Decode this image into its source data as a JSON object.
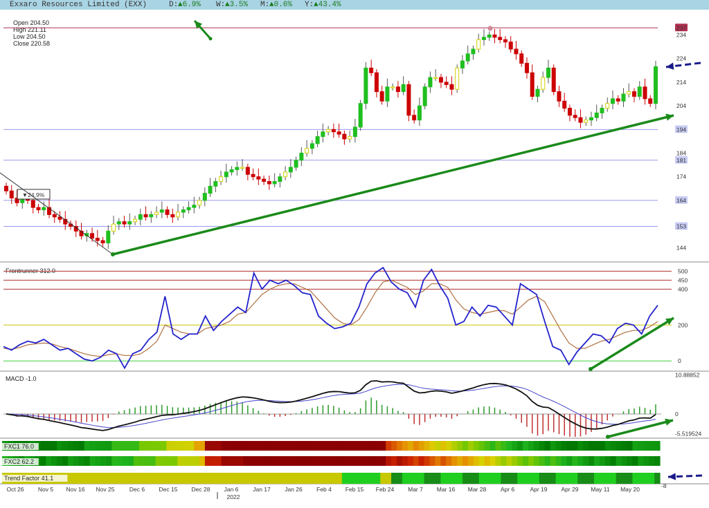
{
  "header": {
    "title": "Exxaro Resources Limited (EXX)",
    "d_label": "D:",
    "d_value": "▲6.9%",
    "w_label": "W:",
    "w_value": "▲3.5%",
    "m_label": "M:",
    "m_value": "▲0.6%",
    "y_label": "Y:",
    "y_value": "▲43.4%"
  },
  "ohlc": {
    "open": "Open 204.50",
    "high": "High 221.11",
    "low": "Low 204.50",
    "close": "Close 220.58"
  },
  "colors": {
    "up_green": "#1fbf1f",
    "up_yellow": "#d4d400",
    "down_red": "#cc0000",
    "trend_arrow": "#1a8a1a",
    "hline_blue": "#9999ee",
    "hline_red": "#b03050",
    "osc_blue": "#2222cc",
    "osc_brown": "#b07040",
    "topbar": "#a9d4e4",
    "trend_yellow": "#c8c800",
    "trend_green": "#1fcf1f",
    "trend_darkgreen": "#178c17"
  },
  "chart_data": [
    {
      "type": "candlestick",
      "price_axis": [
        "234",
        "224",
        "214",
        "204",
        "184",
        "174",
        "144"
      ],
      "levels": [
        {
          "value": "237",
          "color": "red"
        },
        {
          "value": "194",
          "color": "blue"
        },
        {
          "value": "181",
          "color": "blue"
        },
        {
          "value": "164",
          "color": "blue"
        },
        {
          "value": "153",
          "color": "blue"
        }
      ],
      "annotation": "▼24.9%",
      "x_labels": [
        "Oct 26",
        "Nov 5",
        "Nov 16",
        "Nov 25",
        "Dec 6",
        "Dec 15",
        "Dec 28",
        "Jan 6",
        "Jan 17",
        "Jan 26",
        "Feb 4",
        "Feb 15",
        "Feb 24",
        "Mar 7",
        "Mar 16",
        "Mar 28",
        "Apr 6",
        "Apr 19",
        "Apr 29",
        "May 11",
        "May 20"
      ],
      "year_label": "2022",
      "closes": [
        168,
        165,
        163,
        166,
        164,
        161,
        160,
        161,
        158,
        157,
        156,
        154,
        153,
        151,
        149,
        150,
        148,
        147,
        146,
        151,
        154,
        155,
        154,
        155,
        156,
        158,
        157,
        158,
        159,
        160,
        158,
        157,
        159,
        160,
        161,
        162,
        164,
        167,
        170,
        172,
        174,
        176,
        177,
        178,
        178,
        175,
        174,
        173,
        172,
        171,
        172,
        174,
        176,
        178,
        181,
        184,
        186,
        188,
        191,
        193,
        194,
        193,
        192,
        190,
        191,
        195,
        205,
        220,
        218,
        210,
        206,
        212,
        212,
        210,
        213,
        200,
        198,
        204,
        212,
        216,
        216,
        214,
        213,
        211,
        220,
        223,
        226,
        228,
        232,
        233,
        234,
        233,
        232,
        231,
        228,
        226,
        222,
        218,
        208,
        211,
        216,
        220,
        210,
        206,
        203,
        200,
        199,
        197,
        198,
        199,
        201,
        203,
        205,
        207,
        206,
        209,
        210,
        208,
        212,
        207,
        205,
        220.58
      ]
    },
    {
      "type": "line",
      "title": "Frontrunner 312.0",
      "y_ticks": [
        "500",
        "450",
        "400",
        "200",
        "0"
      ],
      "series": [
        {
          "values": [
            80,
            60,
            90,
            110,
            100,
            120,
            90,
            60,
            70,
            40,
            10,
            0,
            20,
            60,
            40,
            -40,
            40,
            60,
            120,
            160,
            360,
            150,
            120,
            150,
            150,
            250,
            170,
            220,
            260,
            300,
            270,
            490,
            400,
            450,
            430,
            450,
            420,
            380,
            370,
            250,
            210,
            180,
            190,
            210,
            300,
            430,
            490,
            520,
            440,
            400,
            380,
            300,
            450,
            510,
            420,
            350,
            200,
            220,
            300,
            250,
            310,
            300,
            250,
            200,
            430,
            400,
            370,
            220,
            80,
            60,
            -20,
            50,
            100,
            150,
            140,
            100,
            180,
            210,
            200,
            150,
            250,
            310
          ]
        },
        {
          "values": [
            70,
            65,
            75,
            90,
            95,
            100,
            95,
            80,
            70,
            55,
            40,
            30,
            25,
            35,
            40,
            30,
            30,
            40,
            70,
            110,
            200,
            180,
            160,
            150,
            150,
            180,
            190,
            200,
            220,
            260,
            270,
            320,
            370,
            400,
            420,
            430,
            430,
            410,
            390,
            340,
            290,
            240,
            210,
            200,
            230,
            300,
            380,
            440,
            450,
            430,
            410,
            370,
            390,
            430,
            430,
            410,
            340,
            290,
            270,
            260,
            270,
            280,
            280,
            260,
            300,
            340,
            360,
            330,
            250,
            170,
            100,
            70,
            70,
            90,
            110,
            120,
            140,
            160,
            170,
            170,
            190,
            220
          ]
        }
      ]
    },
    {
      "type": "line",
      "title": "MACD -1.0",
      "y_ticks": [
        "10.88852",
        "0",
        "-5.519524"
      ]
    },
    {
      "type": "heatmap",
      "rows": [
        {
          "label": "FXC1 76.0"
        },
        {
          "label": "FXC2 62.2"
        },
        {
          "label": "Trend Factor 41.1"
        }
      ],
      "corner_label": "-8"
    }
  ]
}
